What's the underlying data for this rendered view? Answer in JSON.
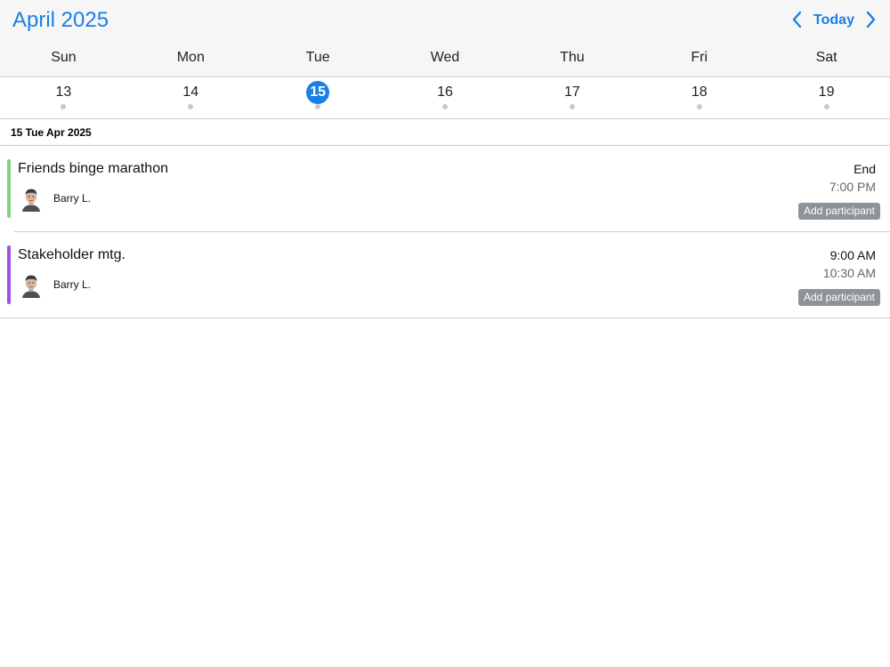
{
  "header": {
    "month_title": "April 2025",
    "today_label": "Today",
    "background": "#f6f6f6",
    "accent": "#1a7fe6"
  },
  "weekdays": [
    "Sun",
    "Mon",
    "Tue",
    "Wed",
    "Thu",
    "Fri",
    "Sat"
  ],
  "dates": [
    {
      "num": "13",
      "selected": false
    },
    {
      "num": "14",
      "selected": false
    },
    {
      "num": "15",
      "selected": true
    },
    {
      "num": "16",
      "selected": false
    },
    {
      "num": "17",
      "selected": false
    },
    {
      "num": "18",
      "selected": false
    },
    {
      "num": "19",
      "selected": false
    }
  ],
  "day_label": "15 Tue Apr 2025",
  "events": [
    {
      "title": "Friends binge marathon",
      "participant": "Barry L.",
      "start": "End",
      "end": "7:00 PM",
      "add_label": "Add participant",
      "color": "#7ed47e"
    },
    {
      "title": "Stakeholder mtg.",
      "participant": "Barry L.",
      "start": "9:00 AM",
      "end": "10:30 AM",
      "add_label": "Add participant",
      "color": "#a04fe6"
    }
  ],
  "icons": {
    "prev": "chevron-left-icon",
    "next": "chevron-right-icon",
    "avatar": "avatar-icon"
  }
}
